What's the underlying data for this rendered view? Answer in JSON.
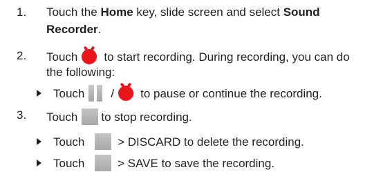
{
  "steps": [
    {
      "number": "1.",
      "line1": {
        "prefix": "Touch the ",
        "bold1": "Home",
        "middle": " key, slide screen and select ",
        "bold2": "Sound"
      },
      "line2": {
        "bold": "Recorder",
        "suffix": "."
      }
    },
    {
      "number": "2.",
      "line1": {
        "prefix": "Touch",
        "suffix": "to start recording. During recording, you can do"
      },
      "line2": "the following:",
      "sub": {
        "prefix": "Touch",
        "separator": "/",
        "suffix": "to pause or continue the recording."
      }
    },
    {
      "number": "3.",
      "line1": {
        "prefix": "Touch",
        "suffix": "to stop recording."
      },
      "subs": [
        {
          "prefix": "Touch",
          "suffix": " > DISCARD to delete the recording."
        },
        {
          "prefix": "Touch",
          "suffix": " > SAVE to save the recording."
        }
      ]
    }
  ],
  "icons": {
    "record": "record-icon",
    "pause": "pause-icon",
    "stop": "stop-icon",
    "bullet": "triangle-bullet-icon"
  },
  "colors": {
    "text": "#231f20",
    "record": "#e8161a",
    "gray_icon": "#b3b3b3"
  }
}
